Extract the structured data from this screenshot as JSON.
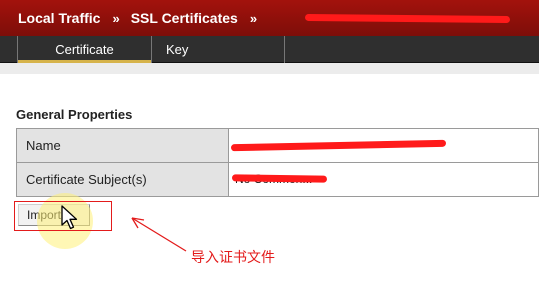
{
  "header": {
    "breadcrumb_1": "Local Traffic",
    "separator_1": "»",
    "breadcrumb_2": "SSL Certificates",
    "separator_2": "»"
  },
  "tabs": [
    {
      "label": "Certificate",
      "active": true
    },
    {
      "label": "Key",
      "active": false
    }
  ],
  "general_properties": {
    "title": "General Properties",
    "rows": [
      {
        "label": "Name",
        "value": ""
      },
      {
        "label": "Certificate Subject(s)",
        "value": "No Common..."
      }
    ]
  },
  "import_button_label": "Import...",
  "annotation_text": "导入证书文件",
  "colors": {
    "header_bg": "#8f100a",
    "tab_bar_bg": "#2f2f2f",
    "active_tab_underline": "#d6b34a",
    "redaction": "#ff1a1a",
    "annotation": "#e31b1b",
    "label_cell_bg": "#e3e3e3"
  },
  "icons": {
    "cursor": "mouse-pointer-icon",
    "annotation_arrow": "arrow-icon"
  }
}
